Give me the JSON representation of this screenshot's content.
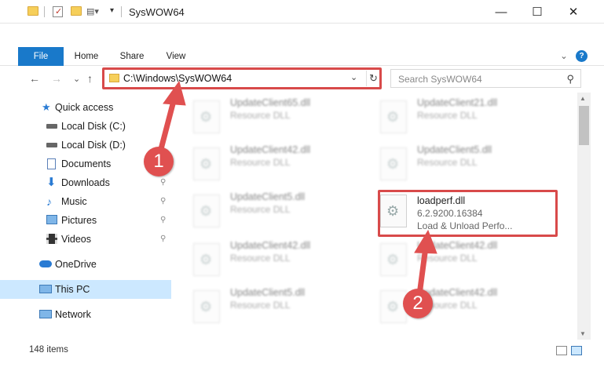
{
  "window": {
    "title": "SysWOW64",
    "minimize_icon": "—",
    "maximize_icon": "☐",
    "close_icon": "✕"
  },
  "ribbon": {
    "tabs": [
      "File",
      "Home",
      "Share",
      "View"
    ],
    "collapse_icon": "⌄",
    "help_icon": "?"
  },
  "navigation": {
    "back_icon": "←",
    "forward_icon": "→",
    "recent_icon": "⌄",
    "up_icon": "↑"
  },
  "address": {
    "path": "C:\\Windows\\SysWOW64",
    "dropdown_icon": "⌄",
    "refresh_icon": "↻"
  },
  "search": {
    "placeholder": "Search SysWOW64",
    "icon": "⚲"
  },
  "sidebar": {
    "items": [
      {
        "label": "Quick access",
        "icon": "star-icon"
      },
      {
        "label": "Local Disk (C:)",
        "icon": "drive-icon"
      },
      {
        "label": "Local Disk (D:)",
        "icon": "drive-icon"
      },
      {
        "label": "Documents",
        "icon": "documents-icon"
      },
      {
        "label": "Downloads",
        "icon": "download-icon"
      },
      {
        "label": "Music",
        "icon": "music-icon"
      },
      {
        "label": "Pictures",
        "icon": "pictures-icon"
      },
      {
        "label": "Videos",
        "icon": "videos-icon"
      },
      {
        "label": "OneDrive",
        "icon": "cloud-icon"
      },
      {
        "label": "This PC",
        "icon": "computer-icon"
      },
      {
        "label": "Network",
        "icon": "network-icon"
      }
    ],
    "pin_glyph": "📌"
  },
  "files": [
    {
      "name": "UpdateClient65.dll",
      "desc": "Resource DLL"
    },
    {
      "name": "UpdateClient21.dll",
      "desc": "Resource DLL"
    },
    {
      "name": "UpdateClient42.dll",
      "desc": "Resource DLL"
    },
    {
      "name": "UpdateClient5.dll",
      "desc": "Resource DLL"
    },
    {
      "name": "UpdateClient5.dll",
      "desc": "Resource DLL"
    },
    {
      "name": "loadperf.dll",
      "version": "6.2.9200.16384",
      "desc": "Load & Unload Perfo..."
    },
    {
      "name": "UpdateClient42.dll",
      "desc": "Resource DLL"
    },
    {
      "name": "UpdateClient42.dll",
      "desc": "Resource DLL"
    },
    {
      "name": "UpdateClient5.dll",
      "desc": "Resource DLL"
    },
    {
      "name": "UpdateClient42.dll",
      "desc": "Resource DLL"
    }
  ],
  "status": {
    "item_count": "148 items"
  },
  "annotations": {
    "step1": "1",
    "step2": "2",
    "color": "#d84a4a"
  },
  "colors": {
    "accent": "#1979ca",
    "selection": "#cce8ff",
    "annotation": "#e05050"
  }
}
